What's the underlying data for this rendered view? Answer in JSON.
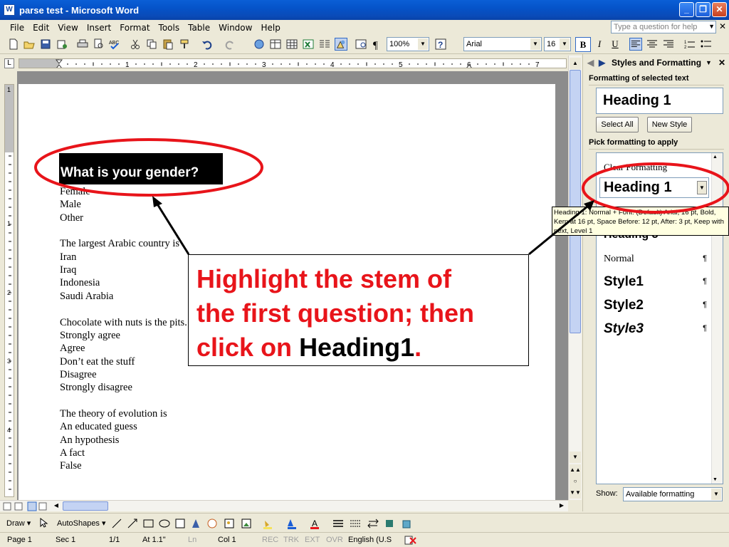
{
  "window": {
    "title": "parse test - Microsoft Word",
    "app_icon": "W"
  },
  "menu": {
    "items": [
      "File",
      "Edit",
      "View",
      "Insert",
      "Format",
      "Tools",
      "Table",
      "Window",
      "Help"
    ],
    "help_placeholder": "Type a question for help"
  },
  "toolbar": {
    "zoom": "100%",
    "font": "Arial",
    "size": "16"
  },
  "ruler": {
    "numbers": [
      "1",
      "2",
      "3",
      "4",
      "5",
      "6",
      "7"
    ],
    "v_numbers": [
      "1",
      "1",
      "2",
      "3",
      "4"
    ]
  },
  "document": {
    "heading": "What is your gender?",
    "lines": [
      "Female",
      "Male",
      "Other",
      "",
      "The largest Arabic country is",
      "Iran",
      "Iraq",
      "Indonesia",
      "Saudi Arabia",
      "",
      "Chocolate with nuts is the pits.",
      "Strongly agree",
      "Agree",
      "Don’t eat the stuff",
      "Disagree",
      "Strongly disagree",
      "",
      "The theory of evolution is",
      "An educated guess",
      "An hypothesis",
      "A fact",
      "False"
    ]
  },
  "callout": {
    "line1": "Highlight the stem of",
    "line2": "the first question; then",
    "line3_prefix": "click on ",
    "line3_strong": "Heading1",
    "line3_suffix": "."
  },
  "taskpane": {
    "title": "Styles and Formatting",
    "selected_label": "Formatting of selected text",
    "selected_style": "Heading 1",
    "select_all": "Select All",
    "new_style": "New Style",
    "pick_label": "Pick formatting to apply",
    "items": {
      "clear": "Clear Formatting",
      "h1": "Heading 1",
      "h3": "Heading 3",
      "normal": "Normal",
      "style1": "Style1",
      "style2": "Style2",
      "style3": "Style3"
    },
    "pilcrow": "¶",
    "show_label": "Show:",
    "show_value": "Available formatting"
  },
  "tooltip": {
    "text": "Heading 1: Normal + Font: (Default) Arial, 16 pt, Bold, Kern at 16 pt, Space Before:  12 pt, After:  3 pt, Keep with next, Level 1"
  },
  "drawbar": {
    "draw": "Draw",
    "autoshapes": "AutoShapes"
  },
  "status": {
    "page": "Page 1",
    "sec": "Sec 1",
    "pages": "1/1",
    "at": "At 1.1\"",
    "ln": "Ln",
    "col": "Col 1",
    "rec": "REC",
    "trk": "TRK",
    "ext": "EXT",
    "ovr": "OVR",
    "lang": "English (U.S"
  },
  "colors": {
    "annotation_red": "#e8141a",
    "title_blue": "#0553c9",
    "tooltip_bg": "#ffffe1"
  }
}
